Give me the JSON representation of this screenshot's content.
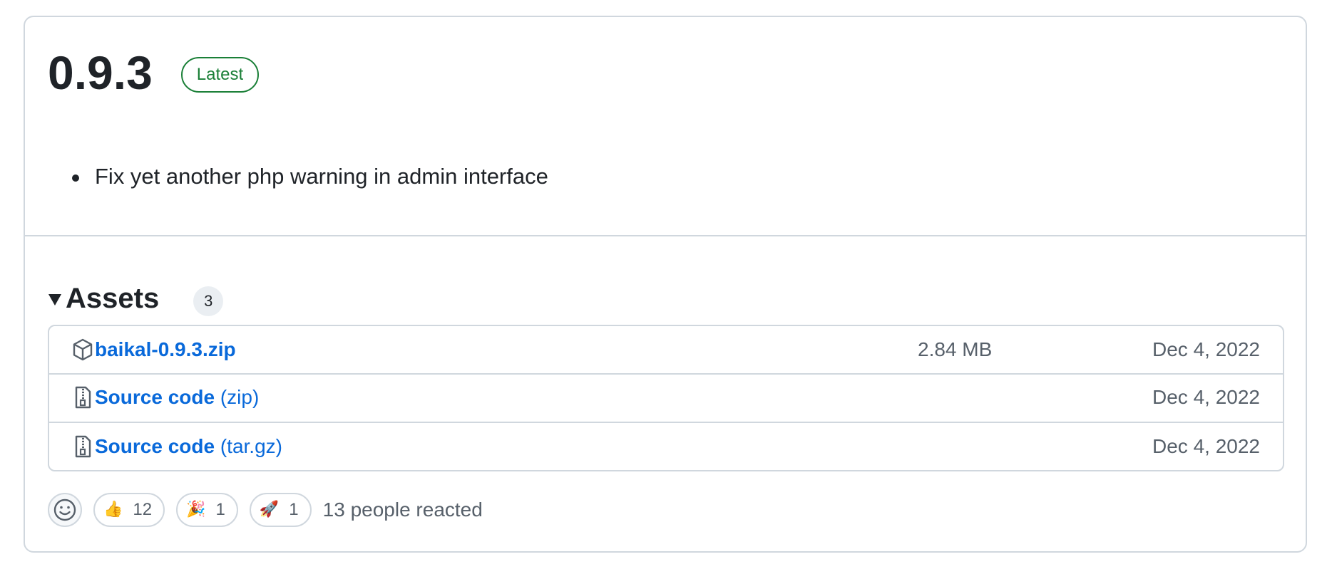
{
  "release": {
    "title": "0.9.3",
    "badge": "Latest",
    "notes": [
      "Fix yet another php warning in admin interface"
    ]
  },
  "assets": {
    "title": "Assets",
    "count": "3",
    "items": [
      {
        "name": "baikal-0.9.3.zip",
        "suffix": "",
        "size": "2.84 MB",
        "date": "Dec 4, 2022",
        "icon": "package-icon"
      },
      {
        "name": "Source code",
        "suffix": "(zip)",
        "size": "",
        "date": "Dec 4, 2022",
        "icon": "file-zip-icon"
      },
      {
        "name": "Source code",
        "suffix": "(tar.gz)",
        "size": "",
        "date": "Dec 4, 2022",
        "icon": "file-zip-icon"
      }
    ]
  },
  "reactions": {
    "items": [
      {
        "emoji": "👍",
        "count": "12"
      },
      {
        "emoji": "🎉",
        "count": "1"
      },
      {
        "emoji": "🚀",
        "count": "1"
      }
    ],
    "summary": "13 people reacted"
  },
  "colors": {
    "link": "#0969da",
    "badge": "#1a7f37",
    "border": "#d0d7de",
    "muted": "#57606a"
  }
}
